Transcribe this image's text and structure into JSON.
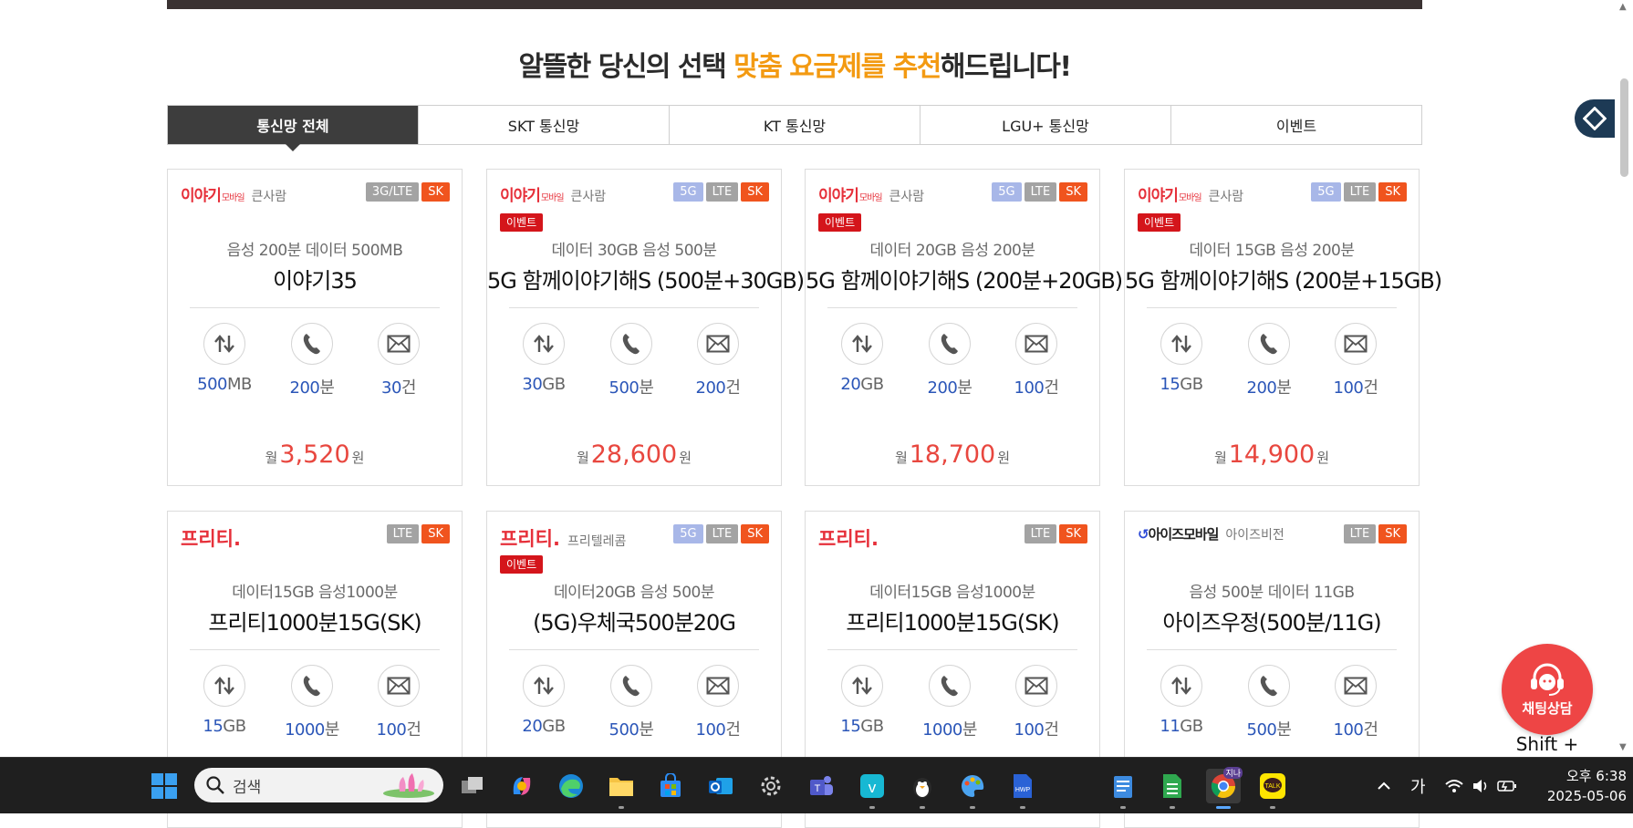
{
  "headline": {
    "part1": "알뜰한 당신의 선택 ",
    "highlight": "맞춤 요금제를 추천",
    "part2": "해드립니다!"
  },
  "tabs": [
    {
      "label": "통신망 전체",
      "active": true
    },
    {
      "label": "SKT 통신망",
      "active": false
    },
    {
      "label": "KT 통신망",
      "active": false
    },
    {
      "label": "LGU+ 통신망",
      "active": false
    },
    {
      "label": "이벤트",
      "active": false
    }
  ],
  "cards": [
    {
      "logo_type": "iyagi",
      "logo": "이야기",
      "logo_sub": "모바일",
      "carrier": "큰사람",
      "badges": [
        "3G/LTE",
        "SK"
      ],
      "event": "",
      "summary": "음성 200분 데이터 500MB",
      "name": "이야기35",
      "data_num": "500",
      "data_unit": "MB",
      "voice_num": "200",
      "voice_unit": "분",
      "sms_num": "30",
      "sms_unit": "건",
      "price_prefix": "월",
      "price": "3,520",
      "price_unit": "원"
    },
    {
      "logo_type": "iyagi",
      "logo": "이야기",
      "logo_sub": "모바일",
      "carrier": "큰사람",
      "badges": [
        "5G",
        "LTE",
        "SK"
      ],
      "event": "이벤트",
      "summary": "데이터 30GB 음성 500분",
      "name": "5G 함께이야기해S (500분+30GB)",
      "data_num": "30",
      "data_unit": "GB",
      "voice_num": "500",
      "voice_unit": "분",
      "sms_num": "200",
      "sms_unit": "건",
      "price_prefix": "월",
      "price": "28,600",
      "price_unit": "원"
    },
    {
      "logo_type": "iyagi",
      "logo": "이야기",
      "logo_sub": "모바일",
      "carrier": "큰사람",
      "badges": [
        "5G",
        "LTE",
        "SK"
      ],
      "event": "이벤트",
      "summary": "데이터 20GB 음성 200분",
      "name": "5G 함께이야기해S (200분+20GB)",
      "data_num": "20",
      "data_unit": "GB",
      "voice_num": "200",
      "voice_unit": "분",
      "sms_num": "100",
      "sms_unit": "건",
      "price_prefix": "월",
      "price": "18,700",
      "price_unit": "원"
    },
    {
      "logo_type": "iyagi",
      "logo": "이야기",
      "logo_sub": "모바일",
      "carrier": "큰사람",
      "badges": [
        "5G",
        "LTE",
        "SK"
      ],
      "event": "이벤트",
      "summary": "데이터 15GB 음성 200분",
      "name": "5G 함께이야기해S (200분+15GB)",
      "data_num": "15",
      "data_unit": "GB",
      "voice_num": "200",
      "voice_unit": "분",
      "sms_num": "100",
      "sms_unit": "건",
      "price_prefix": "월",
      "price": "14,900",
      "price_unit": "원"
    },
    {
      "logo_type": "freet",
      "logo": "프리티.",
      "logo_sub": "",
      "carrier": "",
      "badges": [
        "LTE",
        "SK"
      ],
      "event": "",
      "summary": "데이터15GB 음성1000분",
      "name": "프리티1000분15G(SK)",
      "data_num": "15",
      "data_unit": "GB",
      "voice_num": "1000",
      "voice_unit": "분",
      "sms_num": "100",
      "sms_unit": "건",
      "price_prefix": "",
      "price": "",
      "price_unit": ""
    },
    {
      "logo_type": "freet",
      "logo": "프리티.",
      "logo_sub": "",
      "carrier": "프리텔레콤",
      "badges": [
        "5G",
        "LTE",
        "SK"
      ],
      "event": "이벤트",
      "summary": "데이터20GB 음성 500분",
      "name": "(5G)우체국500분20G",
      "data_num": "20",
      "data_unit": "GB",
      "voice_num": "500",
      "voice_unit": "분",
      "sms_num": "100",
      "sms_unit": "건",
      "price_prefix": "",
      "price": "",
      "price_unit": ""
    },
    {
      "logo_type": "freet",
      "logo": "프리티.",
      "logo_sub": "",
      "carrier": "",
      "badges": [
        "LTE",
        "SK"
      ],
      "event": "",
      "summary": "데이터15GB 음성1000분",
      "name": "프리티1000분15G(SK)",
      "data_num": "15",
      "data_unit": "GB",
      "voice_num": "1000",
      "voice_unit": "분",
      "sms_num": "100",
      "sms_unit": "건",
      "price_prefix": "",
      "price": "",
      "price_unit": ""
    },
    {
      "logo_type": "eyes",
      "logo": "아이즈모바일",
      "logo_sub": "",
      "carrier": "아이즈비전",
      "badges": [
        "LTE",
        "SK"
      ],
      "event": "",
      "summary": "음성 500분 데이터 11GB",
      "name": "아이즈우정(500분/11G)",
      "data_num": "11",
      "data_unit": "GB",
      "voice_num": "500",
      "voice_unit": "분",
      "sms_num": "100",
      "sms_unit": "건",
      "price_prefix": "",
      "price": "",
      "price_unit": ""
    }
  ],
  "chat": {
    "label": "채팅상담",
    "hint": "Shift + Enter"
  },
  "taskbar": {
    "search_placeholder": "검색",
    "ime": "가",
    "time": "오후 6:38",
    "date": "2025-05-06",
    "chrome_badge": "지나"
  },
  "colors": {
    "accent_orange": "#f39a12",
    "price_red": "#e8473f",
    "badge_sk": "#f0541e",
    "badge_5g": "#a8b7e8",
    "badge_lte": "#a3a3a3",
    "event_red": "#d4151b",
    "value_blue": "#2b56b8"
  }
}
